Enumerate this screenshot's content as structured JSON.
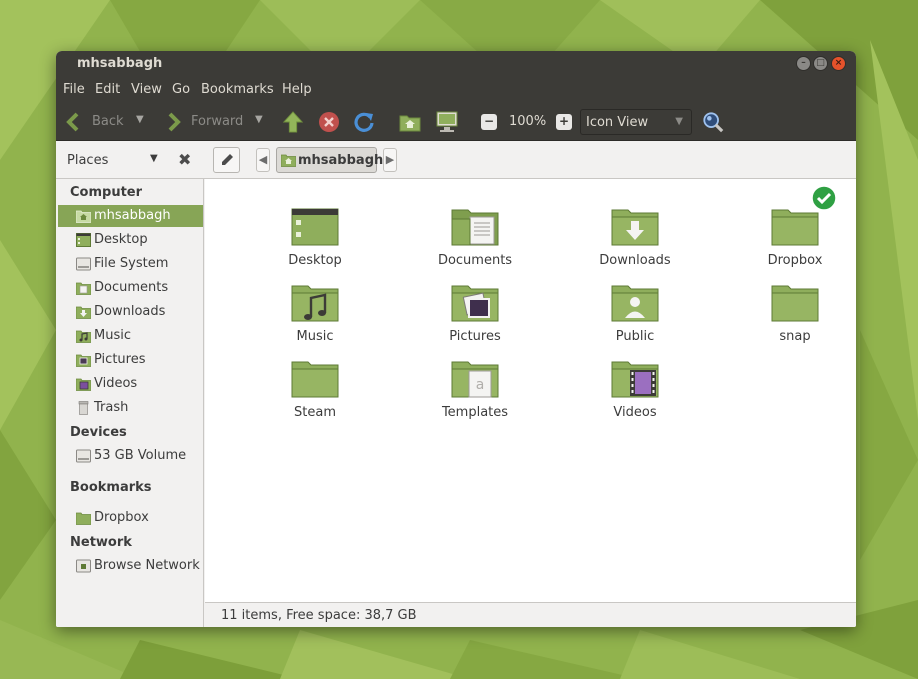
{
  "window": {
    "title": "mhsabbagh",
    "controls": [
      "minimize-icon",
      "maximize-icon",
      "close-icon"
    ]
  },
  "menubar": {
    "items": [
      "File",
      "Edit",
      "View",
      "Go",
      "Bookmarks",
      "Help"
    ]
  },
  "toolbar": {
    "back_label": "Back",
    "forward_label": "Forward",
    "zoom_level": "100%",
    "view_mode": "Icon View",
    "icons": [
      "back-arrow-icon",
      "forward-arrow-icon",
      "up-arrow-icon",
      "stop-icon",
      "reload-icon",
      "home-folder-icon",
      "computer-icon",
      "zoom-out-icon",
      "zoom-in-icon",
      "search-icon"
    ]
  },
  "locationbar": {
    "places_label": "Places",
    "breadcrumb": "mhsabbagh"
  },
  "sidebar": {
    "computer_heading": "Computer",
    "computer_items": [
      {
        "label": "mhsabbagh",
        "icon": "home-folder-icon",
        "selected": true
      },
      {
        "label": "Desktop",
        "icon": "desktop-icon"
      },
      {
        "label": "File System",
        "icon": "drive-icon"
      },
      {
        "label": "Documents",
        "icon": "documents-folder-icon"
      },
      {
        "label": "Downloads",
        "icon": "downloads-folder-icon"
      },
      {
        "label": "Music",
        "icon": "music-folder-icon"
      },
      {
        "label": "Pictures",
        "icon": "pictures-folder-icon"
      },
      {
        "label": "Videos",
        "icon": "videos-folder-icon"
      },
      {
        "label": "Trash",
        "icon": "trash-icon"
      }
    ],
    "devices_heading": "Devices",
    "devices_items": [
      {
        "label": "53 GB Volume",
        "icon": "drive-icon"
      }
    ],
    "bookmarks_heading": "Bookmarks",
    "bookmarks_items": [
      {
        "label": "Dropbox",
        "icon": "folder-icon"
      }
    ],
    "network_heading": "Network",
    "network_items": [
      {
        "label": "Browse Network",
        "icon": "network-icon"
      }
    ]
  },
  "content": {
    "items": [
      {
        "label": "Desktop",
        "icon": "desktop-folder-icon"
      },
      {
        "label": "Documents",
        "icon": "documents-folder-icon"
      },
      {
        "label": "Downloads",
        "icon": "downloads-folder-icon"
      },
      {
        "label": "Dropbox",
        "icon": "dropbox-folder-icon",
        "emblem": "synced-check-icon"
      },
      {
        "label": "Music",
        "icon": "music-folder-icon"
      },
      {
        "label": "Pictures",
        "icon": "pictures-folder-icon"
      },
      {
        "label": "Public",
        "icon": "public-folder-icon"
      },
      {
        "label": "snap",
        "icon": "folder-icon"
      },
      {
        "label": "Steam",
        "icon": "folder-icon"
      },
      {
        "label": "Templates",
        "icon": "templates-folder-icon"
      },
      {
        "label": "Videos",
        "icon": "videos-folder-icon"
      }
    ]
  },
  "statusbar": {
    "text": "11 items, Free space: 38,7 GB"
  },
  "colors": {
    "accent": "#87a556",
    "folder": "#8fae5c",
    "titlebar": "#3c3b37",
    "close_button": "#e5522b"
  }
}
